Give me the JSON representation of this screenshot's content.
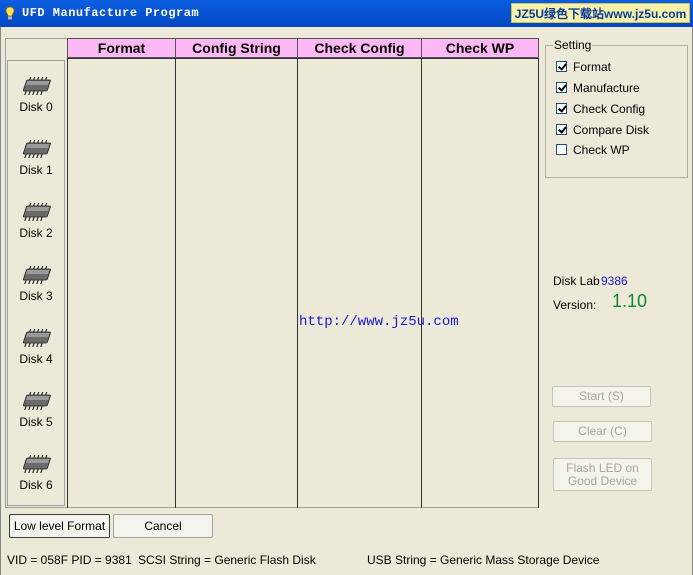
{
  "title_bar": {
    "title": "UFD Manufacture Program",
    "watermark_badge": "JZ5U绿色下载站www.jz5u.com"
  },
  "grid": {
    "columns": [
      "Format",
      "Config String",
      "Check Config",
      "Check WP"
    ],
    "disks": [
      "Disk 0",
      "Disk 1",
      "Disk 2",
      "Disk 3",
      "Disk 4",
      "Disk 5",
      "Disk 6"
    ],
    "watermark_link": "http://www.jz5u.com"
  },
  "setting": {
    "legend": "Setting",
    "options": [
      {
        "label": "Format",
        "checked": true
      },
      {
        "label": "Manufacture",
        "checked": true
      },
      {
        "label": "Check Config",
        "checked": true
      },
      {
        "label": "Compare Disk",
        "checked": true
      },
      {
        "label": "Check WP",
        "checked": false
      }
    ]
  },
  "info": {
    "disk_lab_label": "Disk Lab",
    "disk_lab_value": "9386",
    "version_label": "Version:",
    "version_value": "1.10"
  },
  "buttons": {
    "start": "Start (S)",
    "clear": "Clear (C)",
    "flash_led": "Flash LED on Good Device",
    "low_level_format": "Low level Format",
    "cancel": "Cancel"
  },
  "status_bar": {
    "vid_pid": "VID = 058F  PID = 9381",
    "scsi": "SCSI String = Generic  Flash Disk",
    "usb": "USB String = Generic  Mass Storage Device"
  },
  "colors": {
    "title_bar": "#0348c2",
    "header_fill": "#ffb8f6",
    "version_value": "#0a8a2a",
    "disk_lab_value": "#1a1ab0"
  }
}
